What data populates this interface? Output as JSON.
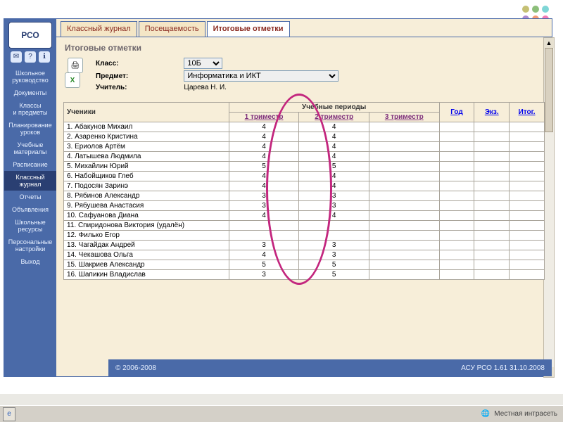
{
  "dots": [
    "#c5c074",
    "#8cbf7a",
    "#7fd6d6",
    "#ac8ad0",
    "#f29a75",
    "#f279b4",
    "#d9d9a1",
    "#a8e0a8",
    "#aee6e6"
  ],
  "sidebar": {
    "logo": "РСО",
    "items": [
      {
        "label": "Школьное\nруководство"
      },
      {
        "label": "Документы"
      },
      {
        "label": "Классы\nи предметы"
      },
      {
        "label": "Планирование\nуроков"
      },
      {
        "label": "Учебные\nматериалы"
      },
      {
        "label": "Расписание"
      },
      {
        "label": "Классный\nжурнал"
      },
      {
        "label": "Отчеты"
      },
      {
        "label": "Объявления"
      },
      {
        "label": "Школьные\nресурсы"
      },
      {
        "label": "Персональные\nнастройки"
      },
      {
        "label": "Выход"
      }
    ],
    "activeIndex": 6
  },
  "tabs": [
    {
      "label": "Классный журнал"
    },
    {
      "label": "Посещаемость"
    },
    {
      "label": "Итоговые отметки"
    }
  ],
  "page": {
    "title": "Итоговые отметки",
    "classLabel": "Класс:",
    "subjectLabel": "Предмет:",
    "teacherLabel": "Учитель:",
    "classValue": "10Б",
    "subjectValue": "Информатика и ИКТ",
    "teacherValue": "Царева Н. И."
  },
  "table": {
    "head": {
      "students": "Ученики",
      "periods": "Учебные периоды",
      "p1": "1 триместр",
      "p2": "2 триместр",
      "p3": "3 триместр",
      "year": "Год",
      "exam": "Экз.",
      "final": "Итог."
    },
    "rows": [
      {
        "n": "1.",
        "name": "Абакунов Михаил",
        "p1": "4",
        "p2": "4",
        "p3": ""
      },
      {
        "n": "2.",
        "name": "Азаренко Кристина",
        "p1": "4",
        "p2": "4",
        "p3": ""
      },
      {
        "n": "3.",
        "name": "Ериолов Артём",
        "p1": "4",
        "p2": "4",
        "p3": ""
      },
      {
        "n": "4.",
        "name": "Латышева Людмила",
        "p1": "4",
        "p2": "4",
        "p3": ""
      },
      {
        "n": "5.",
        "name": "Михайлин Юрий",
        "p1": "5",
        "p2": "5",
        "p3": ""
      },
      {
        "n": "6.",
        "name": "Набойщиков Глеб",
        "p1": "4",
        "p2": "4",
        "p3": ""
      },
      {
        "n": "7.",
        "name": "Подосян Заринэ",
        "p1": "4",
        "p2": "4",
        "p3": ""
      },
      {
        "n": "8.",
        "name": "Рябинов Александр",
        "p1": "3",
        "p2": "3",
        "p3": ""
      },
      {
        "n": "9.",
        "name": "Рябушева Анастасия",
        "p1": "3",
        "p2": "3",
        "p3": ""
      },
      {
        "n": "10.",
        "name": "Сафуанова Диана",
        "p1": "4",
        "p2": "4",
        "p3": ""
      },
      {
        "n": "11.",
        "name": "Спиридонова Виктория (удалён)",
        "p1": "",
        "p2": "",
        "p3": ""
      },
      {
        "n": "12.",
        "name": "Филько Егор",
        "p1": "",
        "p2": "",
        "p3": ""
      },
      {
        "n": "13.",
        "name": "Чагайдак Андрей",
        "p1": "3",
        "p2": "3",
        "p3": ""
      },
      {
        "n": "14.",
        "name": "Чекашова Ольга",
        "p1": "4",
        "p2": "3",
        "p3": ""
      },
      {
        "n": "15.",
        "name": "Шакриев Александр",
        "p1": "5",
        "p2": "5",
        "p3": ""
      },
      {
        "n": "16.",
        "name": "Шапикин Владислав",
        "p1": "3",
        "p2": "5",
        "p3": ""
      }
    ]
  },
  "footer": {
    "copyright": "© 2006-2008",
    "version": "АСУ РСО 1.61   31.10.2008"
  },
  "taskbar": {
    "status": "Местная интрасеть"
  }
}
